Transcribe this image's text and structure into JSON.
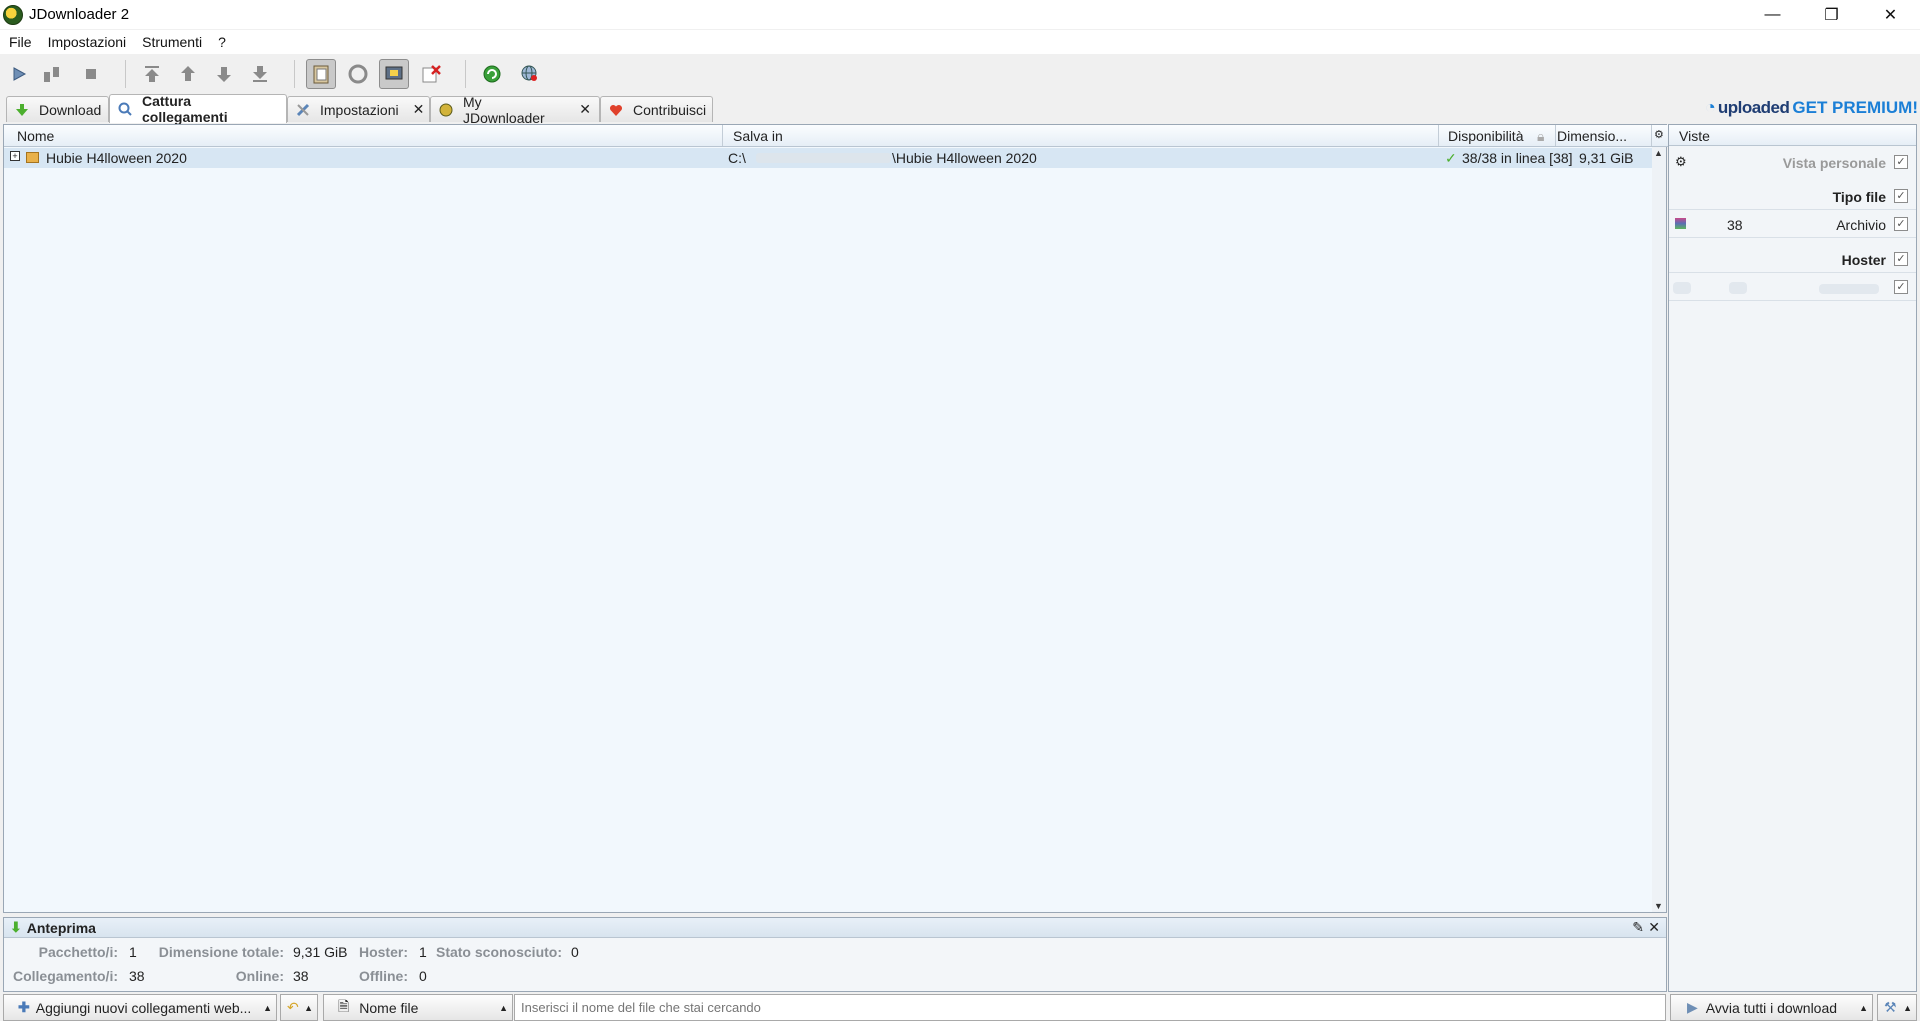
{
  "window": {
    "title": "JDownloader 2"
  },
  "menu": [
    "File",
    "Impostazioni",
    "Strumenti",
    "?"
  ],
  "tabs": [
    {
      "label": "Download",
      "icon": "download-arrow-icon",
      "closable": false
    },
    {
      "label": "Cattura collegamenti",
      "icon": "linkgrabber-icon",
      "closable": false,
      "active": true
    },
    {
      "label": "Impostazioni",
      "icon": "settings-tools-icon",
      "closable": true
    },
    {
      "label": "My JDownloader",
      "icon": "myjd-icon",
      "closable": true
    },
    {
      "label": "Contribuisci",
      "icon": "heart-icon",
      "closable": false
    }
  ],
  "premium": {
    "brand": "uploaded",
    "cta": "GET PREMIUM!"
  },
  "table": {
    "columns": {
      "name": "Nome",
      "save_in": "Salva in",
      "availability": "Disponibilità",
      "size": "Dimensio..."
    },
    "rows": [
      {
        "expander": "+",
        "name": "Hubie H4lloween 2020",
        "save_in_prefix": "C:\\",
        "save_in_suffix": "\\Hubie H4lloween 2020",
        "availability": "38/38 in linea [38]",
        "size": "9,31 GiB"
      }
    ]
  },
  "preview": {
    "title": "Anteprima",
    "labels": {
      "packages": "Pacchetto/i:",
      "total_size": "Dimensione totale:",
      "hoster": "Hoster:",
      "unknown": "Stato sconosciuto:",
      "links": "Collegamento/i:",
      "online": "Online:",
      "offline": "Offline:"
    },
    "values": {
      "packages": "1",
      "total_size": "9,31 GiB",
      "hoster": "1",
      "unknown": "0",
      "links": "38",
      "online": "38",
      "offline": "0"
    }
  },
  "views": {
    "title": "Viste",
    "custom_view": "Vista personale",
    "filetype_header": "Tipo file",
    "filetype_count": "38",
    "filetype_label": "Archivio",
    "hoster_header": "Hoster"
  },
  "bottom": {
    "add_links": "Aggiungi nuovi collegamenti web...",
    "search_field": "Nome file",
    "search_placeholder": "Inserisci il nome del file che stai cercando",
    "start_all": "Avvia tutti i download"
  }
}
